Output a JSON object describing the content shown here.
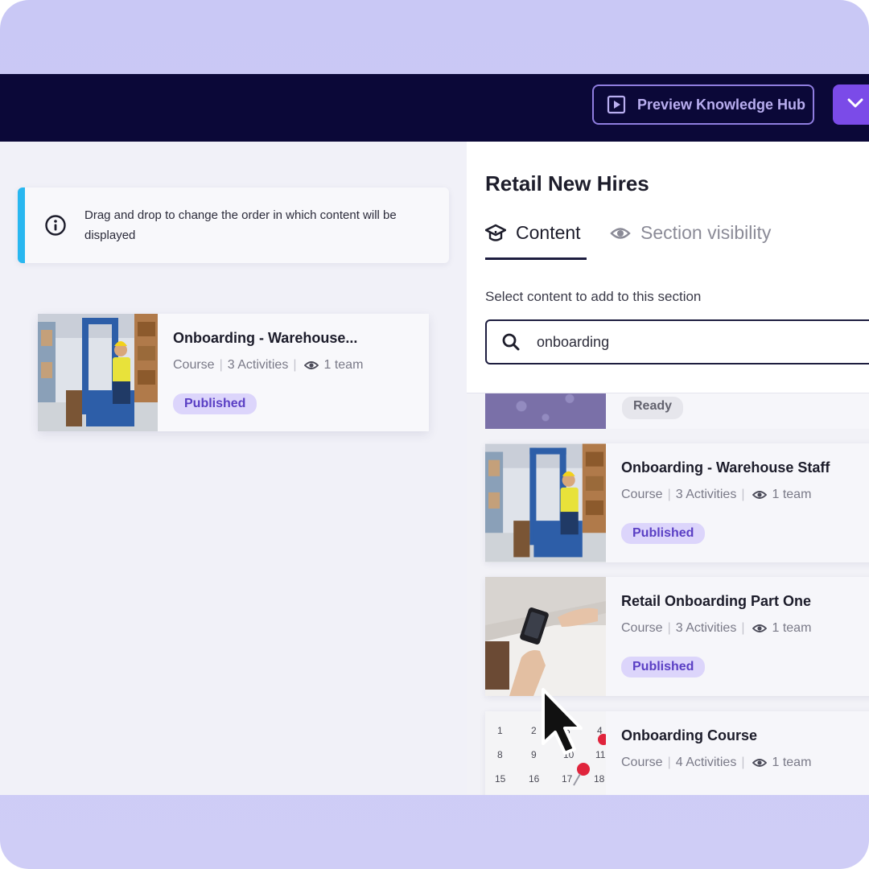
{
  "header": {
    "preview_label": "Preview Knowledge Hub",
    "preview_icon": "play-square-icon",
    "dropdown_icon": "chevron-down-icon",
    "accent": "#7b4be8",
    "bg": "#0b0838"
  },
  "left_panel": {
    "info": {
      "icon": "info-icon",
      "text": "Drag and drop to change the order in which content will be displayed",
      "accent": "#29b7f0"
    },
    "card": {
      "title": "Onboarding - Warehouse...",
      "type": "Course",
      "activities": "3 Activities",
      "teams": "1 team",
      "status": "Published"
    }
  },
  "right_panel": {
    "title": "Retail New Hires",
    "tabs": [
      {
        "label": "Content",
        "icon": "graduation-cap-icon",
        "active": true
      },
      {
        "label": "Section visibility",
        "icon": "eye-icon",
        "active": false
      }
    ],
    "select_label": "Select content to add to this section",
    "search": {
      "value": "onboarding",
      "icon": "search-icon"
    },
    "results": [
      {
        "status": "Ready"
      },
      {
        "title": "Onboarding - Warehouse Staff",
        "type": "Course",
        "activities": "3 Activities",
        "teams": "1 team",
        "status": "Published"
      },
      {
        "title": "Retail Onboarding Part One",
        "type": "Course",
        "activities": "3 Activities",
        "teams": "1 team",
        "status": "Published"
      },
      {
        "title": "Onboarding Course",
        "type": "Course",
        "activities": "4 Activities",
        "teams": "1 team"
      }
    ],
    "calendar_days": [
      "1",
      "2",
      "3",
      "4",
      "8",
      "9",
      "10",
      "11",
      "15",
      "16",
      "17",
      "18"
    ]
  },
  "colors": {
    "published_bg": "#dcd5fb",
    "published_text": "#5a3fc4",
    "frame": "#c9c8f5"
  }
}
